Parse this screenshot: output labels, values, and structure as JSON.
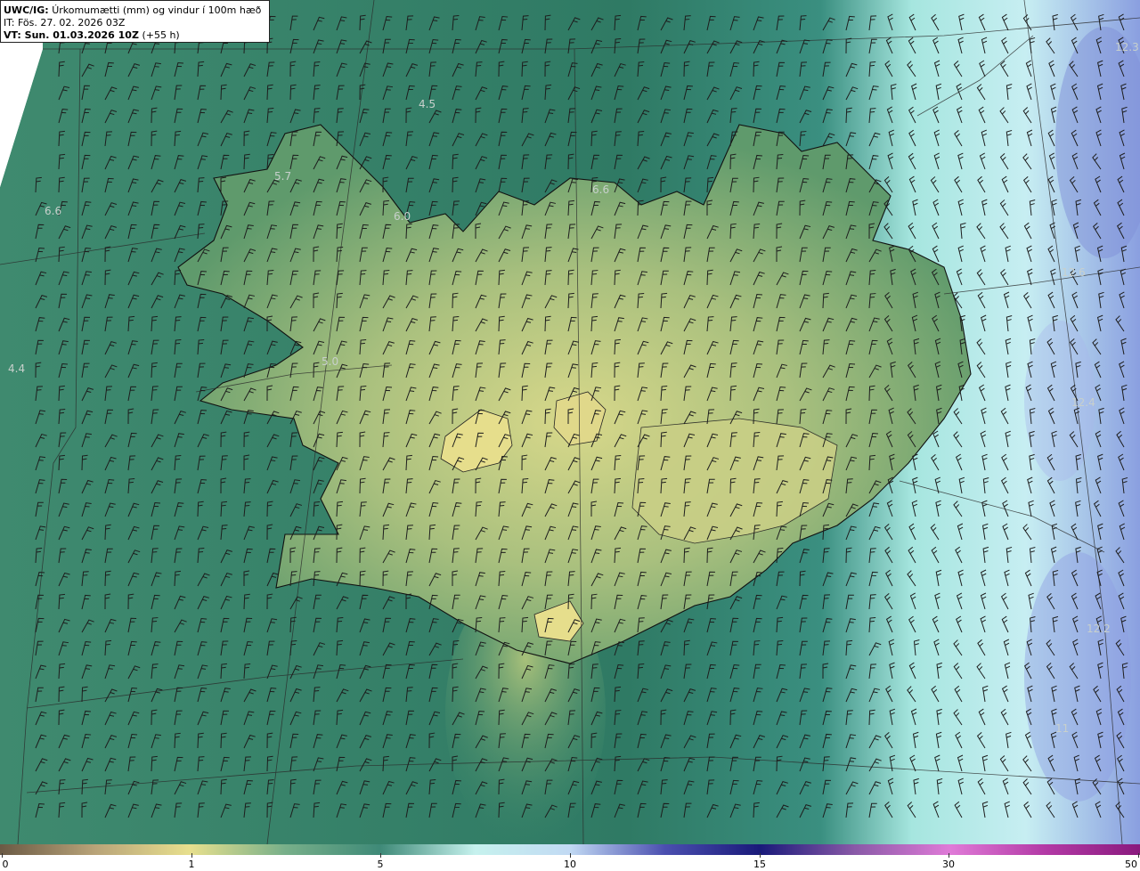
{
  "header": {
    "model": "UWC/IG:",
    "description": "Úrkomumætti (mm) og vindur í 100m hæð",
    "issue_time": "IT: Fös. 27. 02. 2026 03Z",
    "valid_prefix": "VT: Sun. 01.03.2026 10Z",
    "valid_suffix": "(+55 h)"
  },
  "map_labels": [
    {
      "text": "4.5"
    },
    {
      "text": "5.7"
    },
    {
      "text": "6.0"
    },
    {
      "text": "6.6"
    },
    {
      "text": "6.6"
    },
    {
      "text": "4.4"
    },
    {
      "text": "5.0"
    },
    {
      "text": "12.3"
    },
    {
      "text": "12.6"
    },
    {
      "text": "12.4"
    },
    {
      "text": "12.2"
    },
    {
      "text": "11"
    }
  ],
  "colorbar": {
    "ticks": [
      "0",
      "1",
      "5",
      "10",
      "15",
      "30",
      "50"
    ],
    "stops": [
      "#6b5a45",
      "#b9a479",
      "#e8e08e",
      "#78b08a",
      "#3f8a78",
      "#c6f2ee",
      "#c2daf4",
      "#4b4fb0",
      "#1a1a7a",
      "#8a5aa8",
      "#e07bd8",
      "#b33aa6",
      "#8a1a7e"
    ]
  }
}
